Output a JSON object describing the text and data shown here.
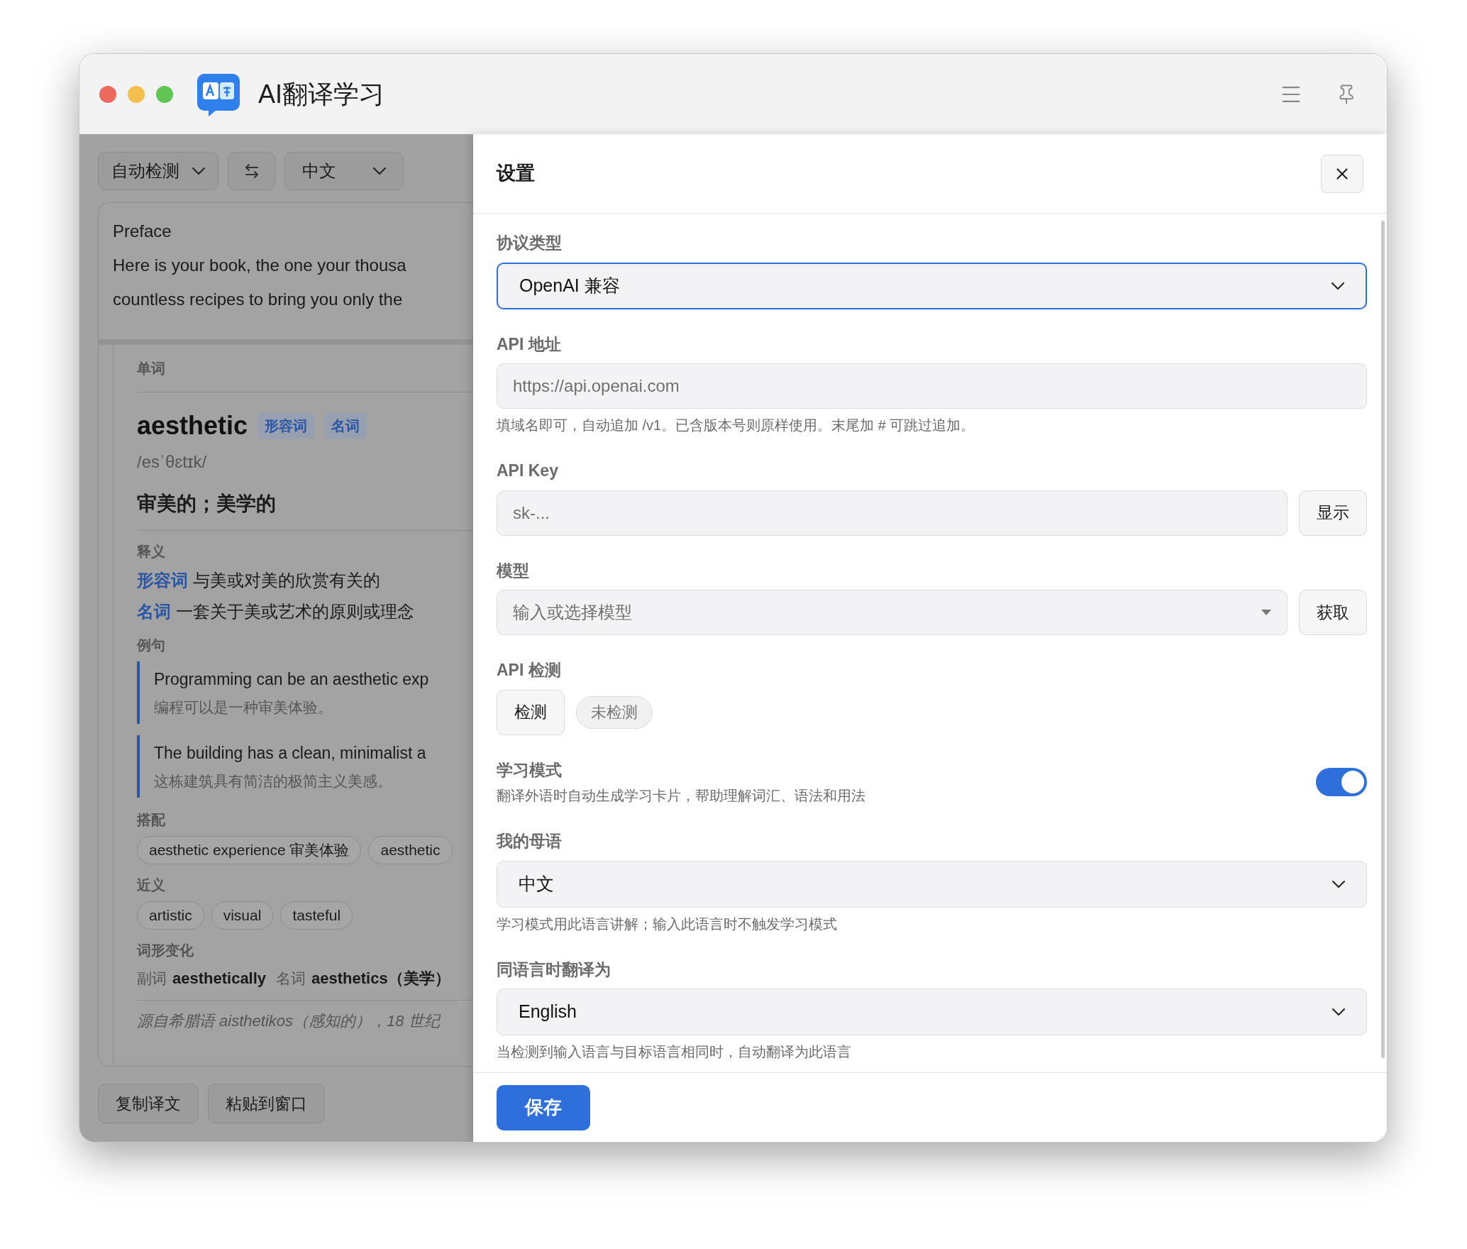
{
  "window": {
    "title": "AI翻译学习"
  },
  "translator": {
    "source_language": "自动检测",
    "target_language": "中文",
    "input_lines": [
      "Preface",
      "Here is your book, the one your thousa",
      "countless recipes to bring you only the"
    ],
    "learning_card": {
      "section_label": "单词",
      "word": "aesthetic",
      "pos_tags": [
        "形容词",
        "名词"
      ],
      "phonetic": "/esˈθɛtɪk/",
      "gloss": "审美的；美学的",
      "definitions_label": "释义",
      "definitions": [
        {
          "pos": "形容词",
          "text": "与美或对美的欣赏有关的"
        },
        {
          "pos": "名词",
          "text": "一套关于美或艺术的原则或理念"
        }
      ],
      "examples_label": "例句",
      "examples": [
        {
          "sentence": "Programming can be an aesthetic exp",
          "translation": "编程可以是一种审美体验。"
        },
        {
          "sentence": "The building has a clean, minimalist a",
          "translation": "这栋建筑具有简洁的极简主义美感。"
        }
      ],
      "collocations_label": "搭配",
      "collocations": [
        "aesthetic experience 审美体验",
        "aesthetic"
      ],
      "synonyms_label": "近义",
      "synonyms": [
        "artistic",
        "visual",
        "tasteful"
      ],
      "forms_label": "词形变化",
      "forms": [
        {
          "pos": "副词",
          "word": "aesthetically"
        },
        {
          "pos": "名词",
          "word": "aesthetics（美学）"
        }
      ],
      "etymology": "源自希腊语 aisthetikos（感知的），18 世纪"
    },
    "actions": [
      "复制译文",
      "粘贴到窗口"
    ]
  },
  "settings": {
    "title": "设置",
    "fields": [
      {
        "kind": "select",
        "label": "协议类型",
        "value": "OpenAI 兼容",
        "focused": true
      },
      {
        "kind": "text",
        "label": "API 地址",
        "placeholder": "https://api.openai.com",
        "hint": "填域名即可，自动追加 /v1。已含版本号则原样使用。末尾加 # 可跳过追加。"
      },
      {
        "kind": "text_button",
        "label": "API Key",
        "placeholder": "sk-...",
        "button": "显示"
      },
      {
        "kind": "combo_button",
        "label": "模型",
        "placeholder": "输入或选择模型",
        "button": "获取"
      },
      {
        "kind": "check",
        "label": "API 检测",
        "button": "检测",
        "status": "未检测"
      },
      {
        "kind": "toggle",
        "label": "学习模式",
        "description": "翻译外语时自动生成学习卡片，帮助理解词汇、语法和用法",
        "on": true
      },
      {
        "kind": "select",
        "label": "我的母语",
        "value": "中文",
        "hint": "学习模式用此语言讲解；输入此语言时不触发学习模式",
        "focused": false
      },
      {
        "kind": "select",
        "label": "同语言时翻译为",
        "value": "English",
        "hint": "当检测到输入语言与目标语言相同时，自动翻译为此语言",
        "focused": false
      }
    ],
    "save": "保存"
  }
}
